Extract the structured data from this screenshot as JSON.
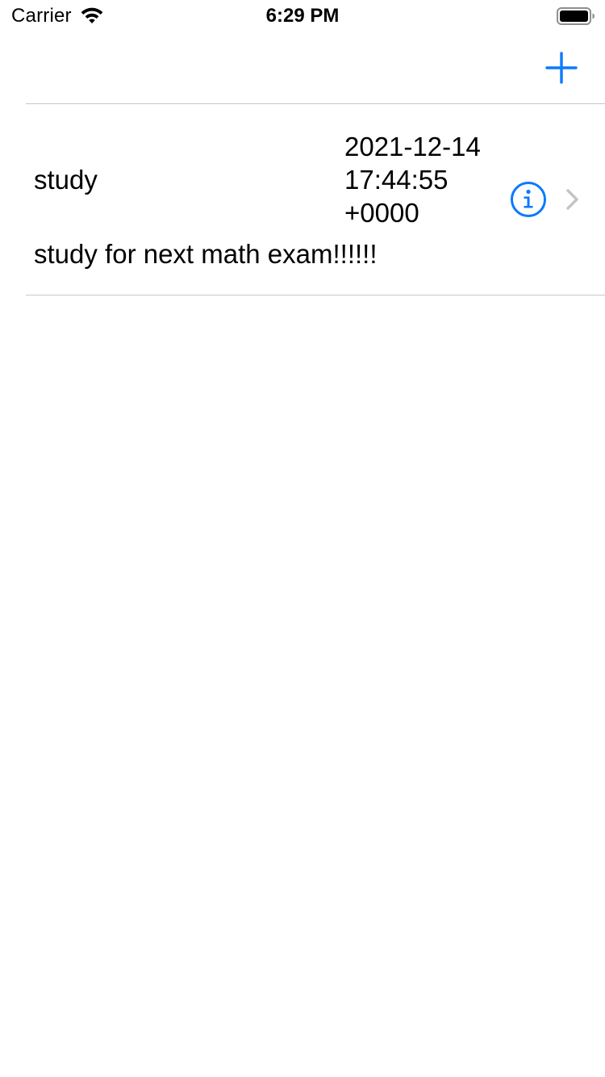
{
  "status_bar": {
    "carrier": "Carrier",
    "time": "6:29 PM"
  },
  "nav_bar": {
    "add_icon": "plus-icon",
    "accent_color": "#0a7aff"
  },
  "list": {
    "items": [
      {
        "title": "study",
        "date": "2021-12-14 17:44:55 +0000",
        "subtitle": "study for next math exam!!!!!!",
        "accessory_icons": [
          "info-icon",
          "chevron-right-icon"
        ]
      }
    ]
  },
  "colors": {
    "separator": "#c8c7cc",
    "chevron": "#c4c4c7",
    "text": "#000000"
  }
}
